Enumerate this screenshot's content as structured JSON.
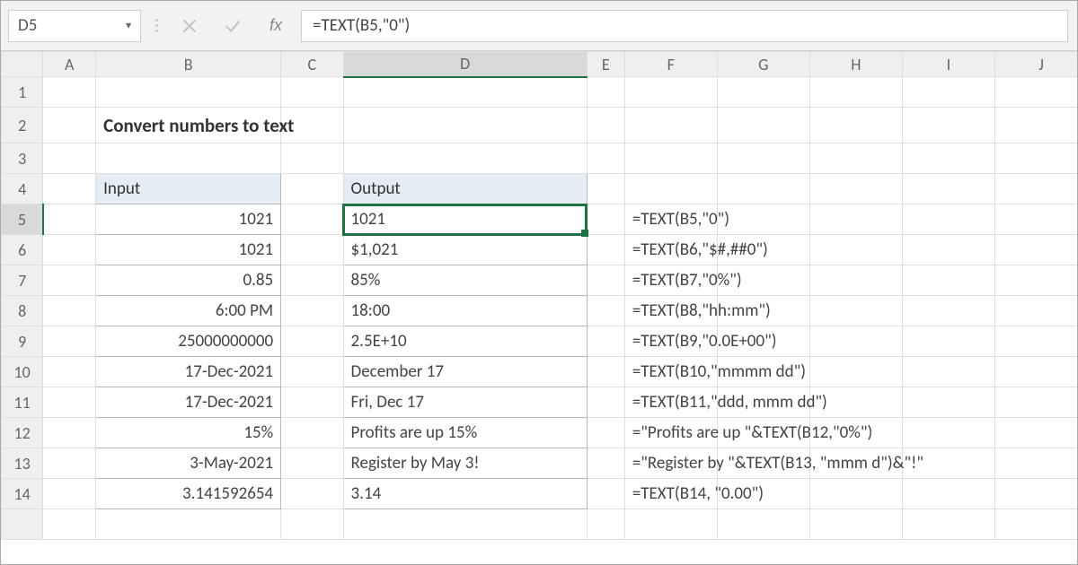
{
  "namebox": {
    "value": "D5"
  },
  "formula_bar": {
    "value": "=TEXT(B5,\"0\")"
  },
  "fx_label": "fx",
  "columns": [
    "A",
    "B",
    "C",
    "D",
    "E",
    "F",
    "G",
    "H",
    "I",
    "J"
  ],
  "row_headers": [
    "1",
    "2",
    "3",
    "4",
    "5",
    "6",
    "7",
    "8",
    "9",
    "10",
    "11",
    "12",
    "13",
    "14"
  ],
  "selected": {
    "col": "D",
    "row": "5"
  },
  "title": "Convert numbers to text",
  "headers": {
    "input": "Input",
    "output": "Output"
  },
  "rows": [
    {
      "input": "1021",
      "output": "1021",
      "formula": "=TEXT(B5,\"0\")"
    },
    {
      "input": "1021",
      "output": "$1,021",
      "formula": "=TEXT(B6,\"$#,##0\")"
    },
    {
      "input": "0.85",
      "output": "85%",
      "formula": "=TEXT(B7,\"0%\")"
    },
    {
      "input": "6:00 PM",
      "output": "18:00",
      "formula": "=TEXT(B8,\"hh:mm\")"
    },
    {
      "input": "25000000000",
      "output": "2.5E+10",
      "formula": "=TEXT(B9,\"0.0E+00\")"
    },
    {
      "input": "17-Dec-2021",
      "output": "December 17",
      "formula": "=TEXT(B10,\"mmmm dd\")"
    },
    {
      "input": "17-Dec-2021",
      "output": "Fri, Dec 17",
      "formula": "=TEXT(B11,\"ddd, mmm dd\")"
    },
    {
      "input": "15%",
      "output": "Profits are up 15%",
      "formula": "=\"Profits are up \"&TEXT(B12,\"0%\")"
    },
    {
      "input": "3-May-2021",
      "output": "Register by May 3!",
      "formula": "=\"Register by \"&TEXT(B13, \"mmm d\")&\"!\""
    },
    {
      "input": "3.141592654",
      "output": "3.14",
      "formula": "=TEXT(B14, \"0.00\")"
    }
  ]
}
